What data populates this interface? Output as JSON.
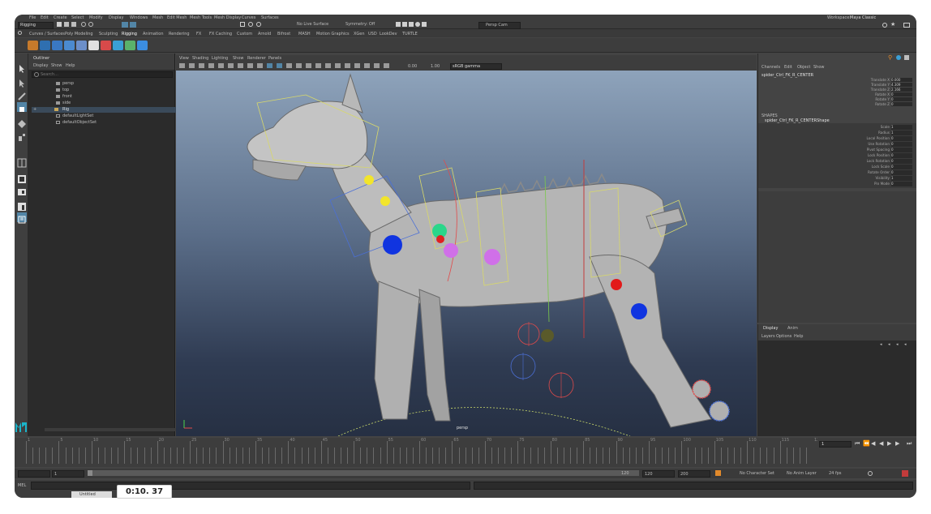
{
  "app": {
    "mode": "Rigging",
    "menubar": [
      "File",
      "Edit",
      "Create",
      "Select",
      "Modify",
      "Display",
      "Windows",
      "Mesh",
      "Edit Mesh",
      "Mesh Tools",
      "Mesh Display",
      "Curves",
      "Surfaces",
      "Deform",
      "UV",
      "Generate",
      "Cache",
      "Arnold",
      "Help"
    ],
    "workspace_label": "Workspace:",
    "workspace_value": "Maya Classic",
    "no_live_surface": "No Live Surface",
    "symmetry": "Symmetry: Off",
    "camera_menu": "Persp Cam"
  },
  "shelf": {
    "tabs": [
      "Curves / Surfaces",
      "Poly Modeling",
      "Sculpting",
      "Rigging",
      "Animation",
      "Rendering",
      "FX",
      "FX Caching",
      "Custom",
      "Arnold",
      "Bifrost",
      "MASH",
      "Motion Graphics",
      "XGen",
      "USD",
      "LookDev",
      "TURTLE"
    ],
    "active_tab": "Rigging",
    "icons": [
      {
        "name": "shelf-joint-icon",
        "color": "#c77a2b"
      },
      {
        "name": "shelf-ik-icon",
        "color": "#2f6fb0"
      },
      {
        "name": "shelf-skin-icon",
        "color": "#3a78c2"
      },
      {
        "name": "shelf-bind-icon",
        "color": "#4b8ad0"
      },
      {
        "name": "shelf-paint-weights-icon",
        "color": "#6c8fc9"
      },
      {
        "name": "shelf-hand-icon",
        "color": "#e0e0e0"
      },
      {
        "name": "shelf-curve-icon",
        "color": "#d74a4a"
      },
      {
        "name": "shelf-cluster-icon",
        "color": "#3a9fd6"
      },
      {
        "name": "shelf-lattice-icon",
        "color": "#5ab26a"
      },
      {
        "name": "shelf-export-icon",
        "color": "#3b8de0"
      }
    ]
  },
  "outliner": {
    "title": "Outliner",
    "menus": [
      "Display",
      "Show",
      "Help"
    ],
    "search_placeholder": "Search...",
    "items": [
      "persp",
      "top",
      "front",
      "side",
      "Rig",
      "defaultLightSet",
      "defaultObjectSet"
    ]
  },
  "viewport": {
    "menus": [
      "View",
      "Shading",
      "Lighting",
      "Show",
      "Renderer",
      "Panels"
    ],
    "gamma": "sRGB gamma",
    "camera_label": "persp",
    "num1": "0.00",
    "num2": "1.00"
  },
  "channel_box": {
    "menus": [
      "Channels",
      "Edit",
      "Object",
      "Show"
    ],
    "object_name": "spider_Ctrl_FK_R_CENTER",
    "attrs": [
      {
        "label": "Translate X",
        "value": "0.000"
      },
      {
        "label": "Translate Y",
        "value": "4.309"
      },
      {
        "label": "Translate Z",
        "value": "2.166"
      },
      {
        "label": "Rotate X",
        "value": "0"
      },
      {
        "label": "Rotate Y",
        "value": "0"
      },
      {
        "label": "Rotate Z",
        "value": "0"
      }
    ],
    "shapes_title": "SHAPES",
    "shape_name": "spider_Ctrl_FK_R_CENTERShape",
    "shape_attrs": [
      {
        "label": "Scale",
        "value": "1"
      },
      {
        "label": "Radius",
        "value": "1"
      },
      {
        "label": "Local Position",
        "value": "0"
      },
      {
        "label": "Use Rotation",
        "value": "0"
      },
      {
        "label": "Pivot Spacing",
        "value": "0"
      },
      {
        "label": "Lock Position",
        "value": "0"
      },
      {
        "label": "Lock Rotation",
        "value": "0"
      },
      {
        "label": "Lock Scale",
        "value": "0"
      },
      {
        "label": "Rotate Order",
        "value": "0"
      },
      {
        "label": "Visibility",
        "value": "1"
      },
      {
        "label": "Pin Mode",
        "value": "0"
      }
    ]
  },
  "layers": {
    "tabs": [
      "Display",
      "Anim"
    ],
    "menus": [
      "Layers",
      "Options",
      "Help"
    ]
  },
  "timeline": {
    "current_frame": "1",
    "start": "1",
    "end": "120",
    "range_end": "120",
    "range_max": "200",
    "fps": "24 fps",
    "character_set": "No Character Set",
    "anim_layer": "No Anim Layer",
    "tick_labels": [
      "1",
      "5",
      "10",
      "15",
      "20",
      "25",
      "30",
      "35",
      "40",
      "45",
      "50",
      "55",
      "60",
      "65",
      "70",
      "75",
      "80",
      "85",
      "90",
      "95",
      "100",
      "105",
      "110",
      "115",
      "120"
    ]
  },
  "command_line": {
    "label": "MEL",
    "tab_label": "Untitled"
  },
  "video_timer": "0:10. 37",
  "colors": {
    "viewport_top": "#8ea3bb",
    "viewport_bottom": "#263043",
    "panel": "#444444",
    "dark_panel": "#2b2b2b",
    "highlight": "#5285a6",
    "accent_blue": "#0066ff"
  }
}
